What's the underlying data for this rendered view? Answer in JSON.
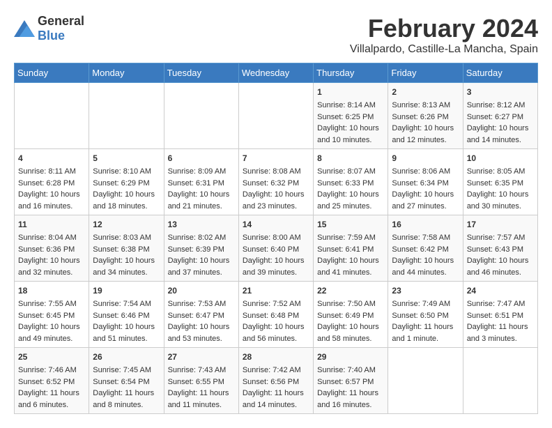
{
  "header": {
    "logo_general": "General",
    "logo_blue": "Blue",
    "title": "February 2024",
    "subtitle": "Villalpardo, Castille-La Mancha, Spain"
  },
  "days_of_week": [
    "Sunday",
    "Monday",
    "Tuesday",
    "Wednesday",
    "Thursday",
    "Friday",
    "Saturday"
  ],
  "weeks": [
    [
      {
        "day": "",
        "info": ""
      },
      {
        "day": "",
        "info": ""
      },
      {
        "day": "",
        "info": ""
      },
      {
        "day": "",
        "info": ""
      },
      {
        "day": "1",
        "info": "Sunrise: 8:14 AM\nSunset: 6:25 PM\nDaylight: 10 hours\nand 10 minutes."
      },
      {
        "day": "2",
        "info": "Sunrise: 8:13 AM\nSunset: 6:26 PM\nDaylight: 10 hours\nand 12 minutes."
      },
      {
        "day": "3",
        "info": "Sunrise: 8:12 AM\nSunset: 6:27 PM\nDaylight: 10 hours\nand 14 minutes."
      }
    ],
    [
      {
        "day": "4",
        "info": "Sunrise: 8:11 AM\nSunset: 6:28 PM\nDaylight: 10 hours\nand 16 minutes."
      },
      {
        "day": "5",
        "info": "Sunrise: 8:10 AM\nSunset: 6:29 PM\nDaylight: 10 hours\nand 18 minutes."
      },
      {
        "day": "6",
        "info": "Sunrise: 8:09 AM\nSunset: 6:31 PM\nDaylight: 10 hours\nand 21 minutes."
      },
      {
        "day": "7",
        "info": "Sunrise: 8:08 AM\nSunset: 6:32 PM\nDaylight: 10 hours\nand 23 minutes."
      },
      {
        "day": "8",
        "info": "Sunrise: 8:07 AM\nSunset: 6:33 PM\nDaylight: 10 hours\nand 25 minutes."
      },
      {
        "day": "9",
        "info": "Sunrise: 8:06 AM\nSunset: 6:34 PM\nDaylight: 10 hours\nand 27 minutes."
      },
      {
        "day": "10",
        "info": "Sunrise: 8:05 AM\nSunset: 6:35 PM\nDaylight: 10 hours\nand 30 minutes."
      }
    ],
    [
      {
        "day": "11",
        "info": "Sunrise: 8:04 AM\nSunset: 6:36 PM\nDaylight: 10 hours\nand 32 minutes."
      },
      {
        "day": "12",
        "info": "Sunrise: 8:03 AM\nSunset: 6:38 PM\nDaylight: 10 hours\nand 34 minutes."
      },
      {
        "day": "13",
        "info": "Sunrise: 8:02 AM\nSunset: 6:39 PM\nDaylight: 10 hours\nand 37 minutes."
      },
      {
        "day": "14",
        "info": "Sunrise: 8:00 AM\nSunset: 6:40 PM\nDaylight: 10 hours\nand 39 minutes."
      },
      {
        "day": "15",
        "info": "Sunrise: 7:59 AM\nSunset: 6:41 PM\nDaylight: 10 hours\nand 41 minutes."
      },
      {
        "day": "16",
        "info": "Sunrise: 7:58 AM\nSunset: 6:42 PM\nDaylight: 10 hours\nand 44 minutes."
      },
      {
        "day": "17",
        "info": "Sunrise: 7:57 AM\nSunset: 6:43 PM\nDaylight: 10 hours\nand 46 minutes."
      }
    ],
    [
      {
        "day": "18",
        "info": "Sunrise: 7:55 AM\nSunset: 6:45 PM\nDaylight: 10 hours\nand 49 minutes."
      },
      {
        "day": "19",
        "info": "Sunrise: 7:54 AM\nSunset: 6:46 PM\nDaylight: 10 hours\nand 51 minutes."
      },
      {
        "day": "20",
        "info": "Sunrise: 7:53 AM\nSunset: 6:47 PM\nDaylight: 10 hours\nand 53 minutes."
      },
      {
        "day": "21",
        "info": "Sunrise: 7:52 AM\nSunset: 6:48 PM\nDaylight: 10 hours\nand 56 minutes."
      },
      {
        "day": "22",
        "info": "Sunrise: 7:50 AM\nSunset: 6:49 PM\nDaylight: 10 hours\nand 58 minutes."
      },
      {
        "day": "23",
        "info": "Sunrise: 7:49 AM\nSunset: 6:50 PM\nDaylight: 11 hours\nand 1 minute."
      },
      {
        "day": "24",
        "info": "Sunrise: 7:47 AM\nSunset: 6:51 PM\nDaylight: 11 hours\nand 3 minutes."
      }
    ],
    [
      {
        "day": "25",
        "info": "Sunrise: 7:46 AM\nSunset: 6:52 PM\nDaylight: 11 hours\nand 6 minutes."
      },
      {
        "day": "26",
        "info": "Sunrise: 7:45 AM\nSunset: 6:54 PM\nDaylight: 11 hours\nand 8 minutes."
      },
      {
        "day": "27",
        "info": "Sunrise: 7:43 AM\nSunset: 6:55 PM\nDaylight: 11 hours\nand 11 minutes."
      },
      {
        "day": "28",
        "info": "Sunrise: 7:42 AM\nSunset: 6:56 PM\nDaylight: 11 hours\nand 14 minutes."
      },
      {
        "day": "29",
        "info": "Sunrise: 7:40 AM\nSunset: 6:57 PM\nDaylight: 11 hours\nand 16 minutes."
      },
      {
        "day": "",
        "info": ""
      },
      {
        "day": "",
        "info": ""
      }
    ]
  ]
}
